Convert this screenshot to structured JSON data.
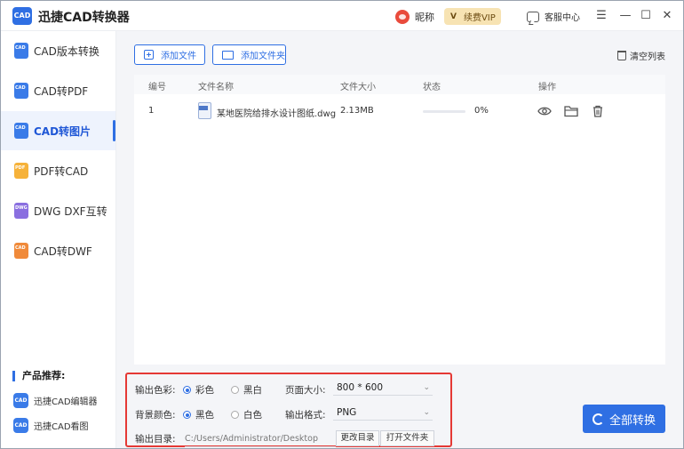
{
  "app": {
    "title": "迅捷CAD转换器",
    "logo_text": "CAD"
  },
  "header": {
    "nickname": "昵称",
    "vip_badge": "V",
    "vip_label": "续费VIP",
    "service_label": "客服中心",
    "menu_glyph": "☰",
    "minimize_glyph": "—",
    "maximize_glyph": "☐",
    "close_glyph": "✕"
  },
  "sidebar": {
    "items": [
      {
        "label": "CAD版本转换",
        "icon": "cad-version-icon",
        "color": "#3a7be8",
        "tag": "CAD"
      },
      {
        "label": "CAD转PDF",
        "icon": "cad-to-pdf-icon",
        "color": "#3a7be8",
        "tag": "CAD"
      },
      {
        "label": "CAD转图片",
        "icon": "cad-to-image-icon",
        "color": "#3a7be8",
        "tag": "CAD"
      },
      {
        "label": "PDF转CAD",
        "icon": "pdf-to-cad-icon",
        "color": "#f6b23a",
        "tag": "PDF"
      },
      {
        "label": "DWG DXF互转",
        "icon": "dwg-dxf-icon",
        "color": "#8a6fe0",
        "tag": "DWG"
      },
      {
        "label": "CAD转DWF",
        "icon": "cad-to-dwf-icon",
        "color": "#f08a3a",
        "tag": "CAD"
      }
    ],
    "active_index": 2,
    "recommend_title": "产品推荐:",
    "recommend_items": [
      {
        "label": "迅捷CAD编辑器",
        "tag": "CAD"
      },
      {
        "label": "迅捷CAD看图",
        "tag": "CAD"
      }
    ]
  },
  "toolbar": {
    "add_file": "添加文件",
    "add_folder": "添加文件夹",
    "clear_list": "清空列表"
  },
  "table": {
    "headers": {
      "index": "编号",
      "name": "文件名称",
      "size": "文件大小",
      "status": "状态",
      "actions": "操作"
    },
    "rows": [
      {
        "index": "1",
        "name": "某地医院给排水设计图纸.dwg",
        "size": "2.13MB",
        "progress_text": "0%",
        "progress": 0
      }
    ]
  },
  "settings": {
    "color_label": "输出色彩:",
    "color_options": [
      "彩色",
      "黑白"
    ],
    "color_selected": 0,
    "bg_label": "背景颜色:",
    "bg_options": [
      "黑色",
      "白色"
    ],
    "bg_selected": 0,
    "page_size_label": "页面大小:",
    "page_size_value": "800 * 600",
    "format_label": "输出格式:",
    "format_value": "PNG",
    "output_dir_label": "输出目录:",
    "output_dir_value": "C:/Users/Administrator/Desktop",
    "change_dir": "更改目录",
    "open_folder": "打开文件夹"
  },
  "convert_all": "全部转换"
}
